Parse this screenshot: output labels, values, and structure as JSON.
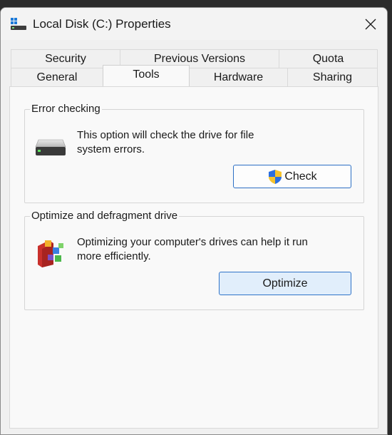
{
  "window": {
    "title": "Local Disk (C:) Properties"
  },
  "tabs": {
    "row1": [
      "Security",
      "Previous Versions",
      "Quota"
    ],
    "row2": [
      "General",
      "Tools",
      "Hardware",
      "Sharing"
    ],
    "active": "Tools"
  },
  "error_checking": {
    "title": "Error checking",
    "description_line1": "This option will check the drive for file",
    "description_line2": "system errors.",
    "button_label": "Check"
  },
  "optimize": {
    "title": "Optimize and defragment drive",
    "description_line1": "Optimizing your computer's drives can help it run",
    "description_line2": "more efficiently.",
    "button_label": "Optimize"
  },
  "icons": {
    "app": "drive-properties-icon",
    "close": "close-icon",
    "drive": "hard-drive-icon",
    "shield": "uac-shield-icon",
    "defrag": "defrag-icon"
  },
  "colors": {
    "accent": "#2c6fc4",
    "focused_button_bg": "#e1eefb"
  }
}
